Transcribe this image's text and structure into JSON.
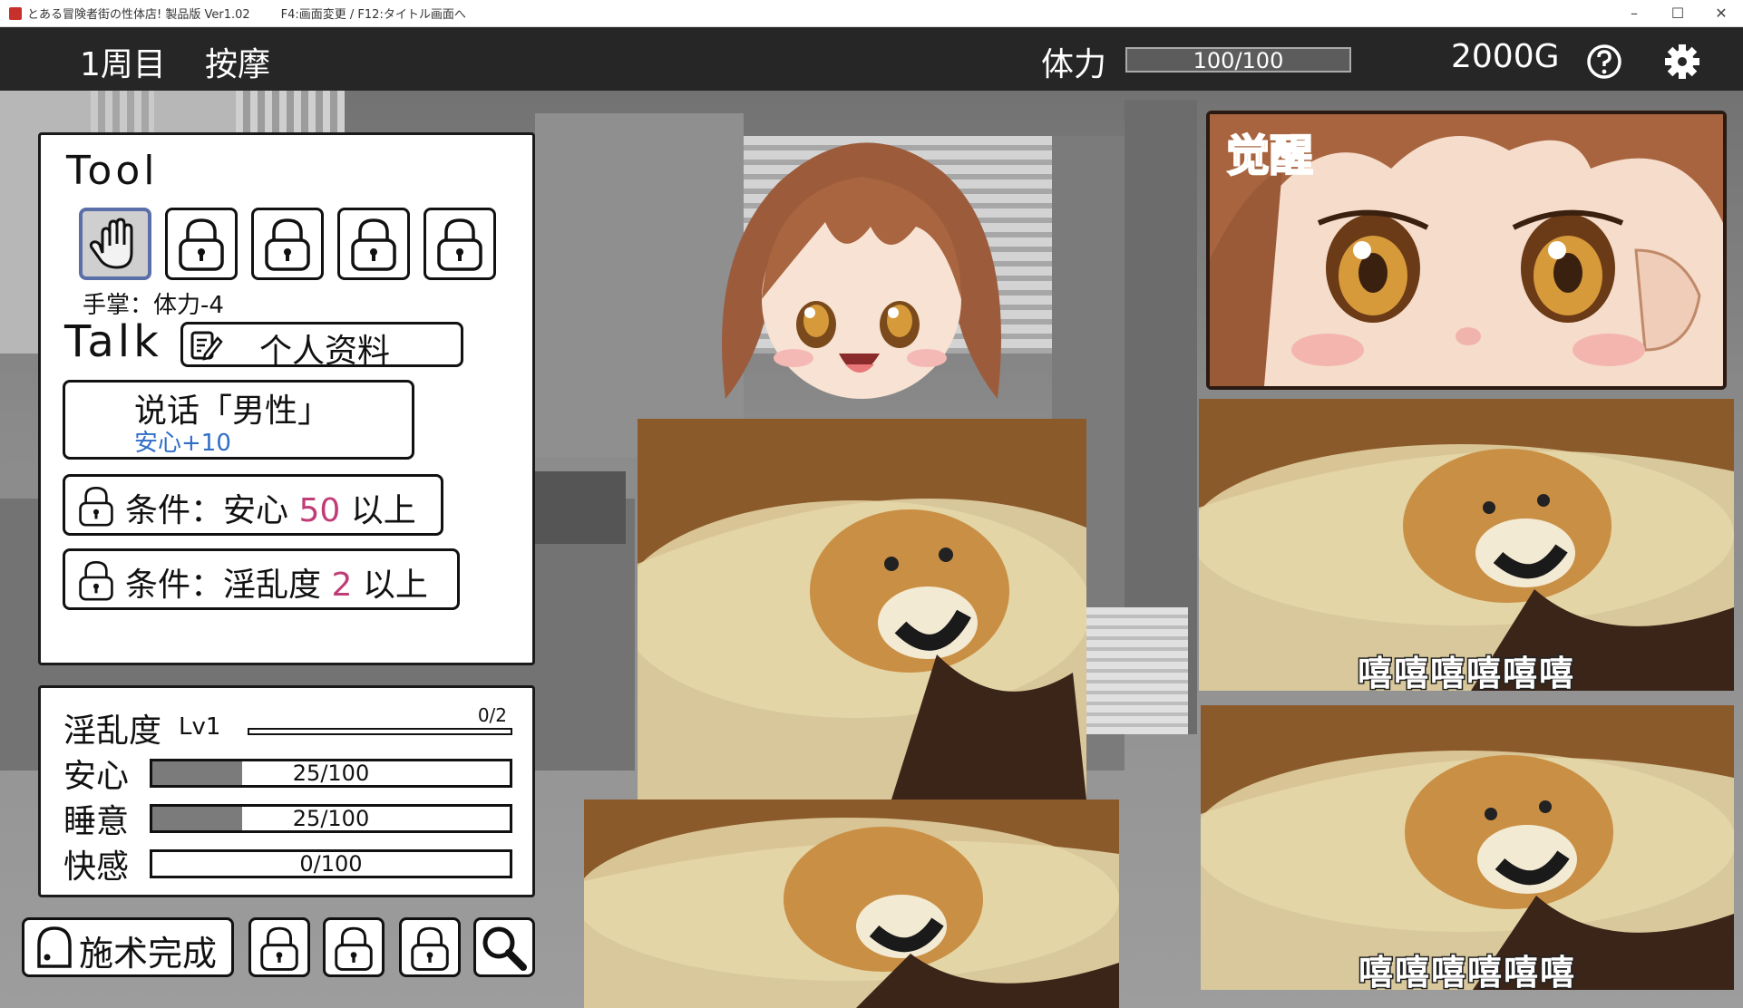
{
  "window": {
    "title": "とある冒険者街の性体店! 製品版 Ver1.02",
    "hint": "F4:画面変更 / F12:タイトル画面へ",
    "controls": [
      "–",
      "☐",
      "✕"
    ]
  },
  "hud": {
    "cycle": "1周目",
    "mode": "按摩",
    "stamina_label": "体力",
    "stamina_value": "100/100",
    "stamina_fraction": 1.0,
    "gold": "2000G",
    "help_icon": "help-icon",
    "settings_icon": "gear-icon"
  },
  "tools": {
    "heading": "Tool",
    "slots": [
      "hand-icon",
      "lock-icon",
      "lock-icon",
      "lock-icon",
      "lock-icon"
    ],
    "selected_desc": "手掌：体力-4"
  },
  "talk": {
    "heading": "Talk",
    "profile_label": "个人资料",
    "speak_label": "说话「男性」",
    "speak_effect": "安心+10",
    "cond1_prefix": "条件：安心",
    "cond1_value": "50",
    "cond1_suffix": "以上",
    "cond2_prefix": "条件：淫乱度",
    "cond2_value": "2",
    "cond2_suffix": "以上"
  },
  "stats": {
    "lewd_label": "淫乱度",
    "lewd_level": "Lv1",
    "lewd_progress": "0/2",
    "lewd_fraction": 0,
    "rows": [
      {
        "label": "安心",
        "value": "25/100",
        "fraction": 0.25
      },
      {
        "label": "睡意",
        "value": "25/100",
        "fraction": 0.25
      },
      {
        "label": "快感",
        "value": "0/100",
        "fraction": 0
      }
    ]
  },
  "bottom": {
    "finish_label": "施术完成",
    "icons": [
      "bell-icon",
      "lock-icon",
      "lock-icon",
      "lock-icon",
      "magnifier-icon"
    ]
  },
  "portrait": {
    "state_label": "觉醒"
  },
  "memes": {
    "caption": "嘻嘻嘻嘻嘻嘻"
  },
  "colors": {
    "hud_bg": "#262626",
    "accent_pink": "#c03c77",
    "effect_blue": "#2f6ec7",
    "awake_orange": "#f0a040"
  }
}
